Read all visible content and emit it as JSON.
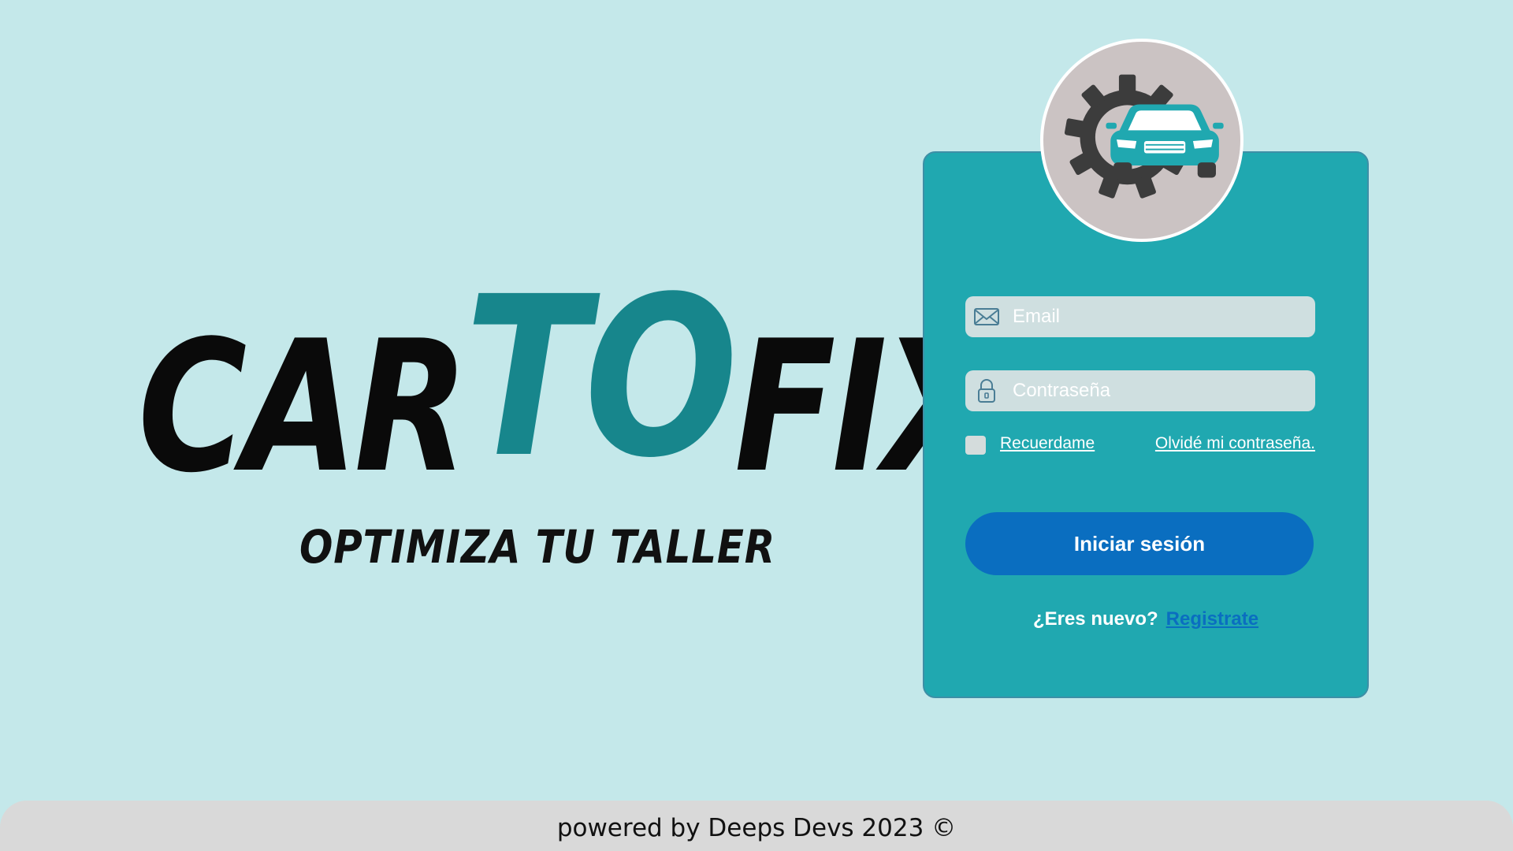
{
  "brand": {
    "wordmark_left": "CAR",
    "wordmark_accent": "TO",
    "wordmark_right": "FIX",
    "tagline": "OPTIMIZA TU TALLER",
    "accent_color": "#17868c"
  },
  "login": {
    "logo_icon": "car-gear-icon",
    "email_icon": "envelope-icon",
    "email_placeholder": "Email",
    "password_icon": "padlock-icon",
    "password_placeholder": "Contraseña",
    "remember_label": "Recuerdame",
    "forgot_label": "Olvidé mi contraseña.",
    "submit_label": "Iniciar sesión",
    "signup_question": "¿Eres nuevo?",
    "signup_link": "Registrate",
    "card_color": "#20a8b0",
    "button_color": "#0a6ec0"
  },
  "footer": {
    "text": "powered by Deeps Devs 2023 ©"
  }
}
